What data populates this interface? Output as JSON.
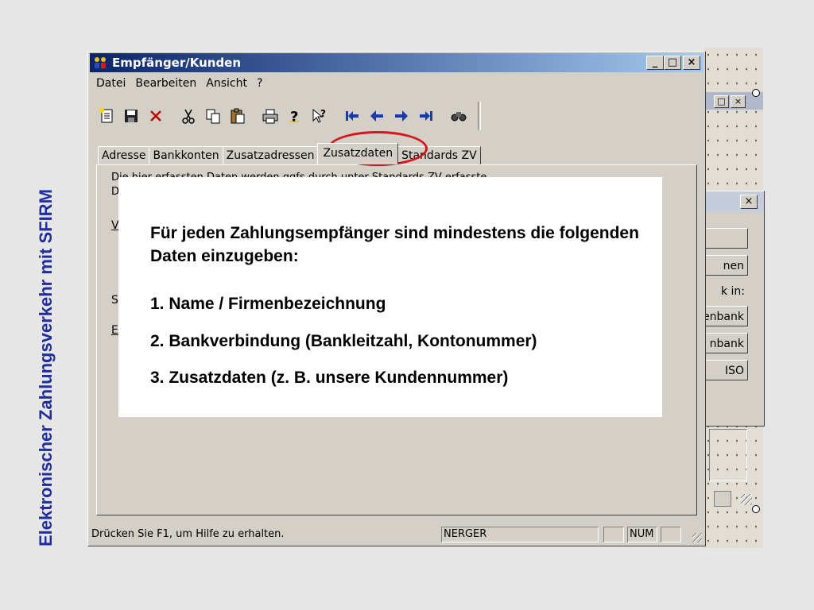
{
  "slide": {
    "vertical_title": "Elektronischer Zahlungsverkehr mit SFIRM"
  },
  "window": {
    "title": "Empfänger/Kunden",
    "controls": {
      "minimize": "_",
      "maximize": "□",
      "close": "×"
    },
    "menu": [
      "Datei",
      "Bearbeiten",
      "Ansicht",
      "?"
    ],
    "toolbar_icons": [
      "new-icon",
      "save-icon",
      "delete-icon",
      "cut-icon",
      "copy-icon",
      "paste-icon",
      "print-icon",
      "help-icon",
      "context-help-icon",
      "first-record-icon",
      "previous-record-icon",
      "next-record-icon",
      "last-record-icon",
      "find-icon"
    ],
    "tabs": [
      "Adresse",
      "Bankkonten",
      "Zusatzadressen",
      "Zusatzdaten",
      "Standards ZV"
    ],
    "active_tab": "Zusatzdaten",
    "panel": {
      "line1": "Die hier erfassten Daten werden ggfs durch unter Standards ZV erfasste",
      "line2": "D",
      "label1": "V",
      "label2": "S",
      "label3": "E"
    },
    "statusbar": {
      "hint": "Drücken Sie F1, um Hilfe zu erhalten.",
      "user": "NERGER",
      "empty": "",
      "num": "NUM"
    }
  },
  "background_dialog": {
    "buttons": [
      "",
      "nen",
      "enbank",
      "nbank",
      "ISO"
    ],
    "label": "k in:"
  },
  "callout": {
    "intro": "Für jeden Zahlungsempfänger sind mindestens die folgenden Daten einzugeben:",
    "items": [
      "1. Name / Firmenbezeichnung",
      "2. Bankverbindung (Bankleitzahl, Kontonummer)",
      "3. Zusatzdaten (z. B. unsere Kundennummer)"
    ]
  },
  "colors": {
    "title_text": "#1f2d9e",
    "highlight_circle": "#d8141c",
    "titlebar_start": "#0a246a",
    "titlebar_end": "#a6caf0"
  }
}
